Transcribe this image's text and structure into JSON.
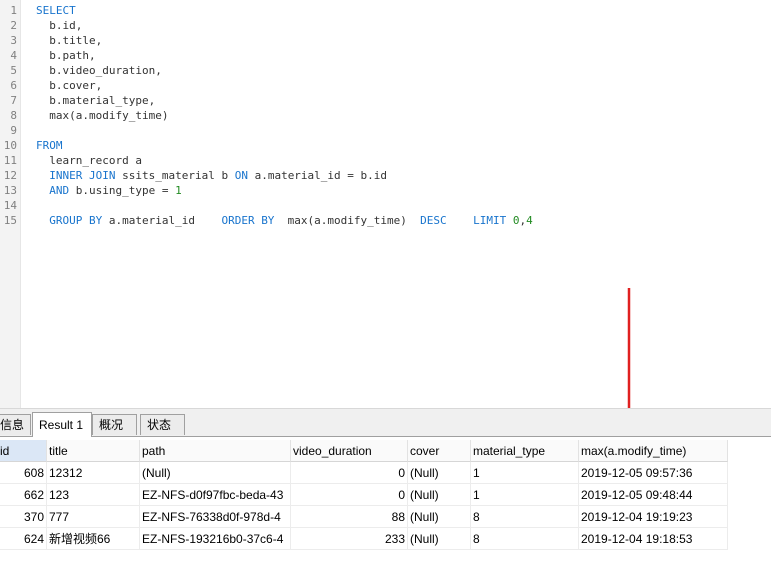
{
  "editor": {
    "lines": [
      {
        "num": "1",
        "parts": [
          {
            "t": "SELECT",
            "c": "kw"
          }
        ]
      },
      {
        "num": "2",
        "parts": [
          {
            "t": "  b.id,",
            "c": ""
          }
        ]
      },
      {
        "num": "3",
        "parts": [
          {
            "t": "  b.title,",
            "c": ""
          }
        ]
      },
      {
        "num": "4",
        "parts": [
          {
            "t": "  b.path,",
            "c": ""
          }
        ]
      },
      {
        "num": "5",
        "parts": [
          {
            "t": "  b.video_duration,",
            "c": ""
          }
        ]
      },
      {
        "num": "6",
        "parts": [
          {
            "t": "  b.cover,",
            "c": ""
          }
        ]
      },
      {
        "num": "7",
        "parts": [
          {
            "t": "  b.material_type,",
            "c": ""
          }
        ]
      },
      {
        "num": "8",
        "parts": [
          {
            "t": "  max(a.modify_time)",
            "c": ""
          }
        ]
      },
      {
        "num": "9",
        "parts": []
      },
      {
        "num": "10",
        "parts": [
          {
            "t": "FROM",
            "c": "kw"
          }
        ]
      },
      {
        "num": "11",
        "parts": [
          {
            "t": "  learn_record a",
            "c": ""
          }
        ]
      },
      {
        "num": "12",
        "parts": [
          {
            "t": "  INNER JOIN",
            "c": "kw"
          },
          {
            "t": " ssits_material b ",
            "c": ""
          },
          {
            "t": "ON",
            "c": "kw"
          },
          {
            "t": " a.material_id = b.id",
            "c": ""
          }
        ]
      },
      {
        "num": "13",
        "parts": [
          {
            "t": "  AND",
            "c": "kw"
          },
          {
            "t": " b.using_type = ",
            "c": ""
          },
          {
            "t": "1",
            "c": "num"
          }
        ]
      },
      {
        "num": "14",
        "parts": []
      },
      {
        "num": "15",
        "parts": [
          {
            "t": "  GROUP BY",
            "c": "kw"
          },
          {
            "t": " a.material_id    ",
            "c": ""
          },
          {
            "t": "ORDER BY",
            "c": "kw"
          },
          {
            "t": "  max(a.modify_time)  ",
            "c": ""
          },
          {
            "t": "DESC",
            "c": "kw"
          },
          {
            "t": "    ",
            "c": ""
          },
          {
            "t": "LIMIT",
            "c": "kw"
          },
          {
            "t": " ",
            "c": ""
          },
          {
            "t": "0",
            "c": "num"
          },
          {
            "t": ",",
            "c": ""
          },
          {
            "t": "4",
            "c": "num"
          }
        ]
      }
    ]
  },
  "tabs": [
    {
      "label": "信息",
      "active": false
    },
    {
      "label": "Result 1",
      "active": true
    },
    {
      "label": "概况",
      "active": false
    },
    {
      "label": "状态",
      "active": false
    }
  ],
  "grid": {
    "columns": [
      "id",
      "title",
      "path",
      "video_duration",
      "cover",
      "material_type",
      "max(a.modify_time)"
    ],
    "rows": [
      [
        "608",
        "12312",
        "(Null)",
        "0",
        "(Null)",
        "1",
        "2019-12-05 09:57:36"
      ],
      [
        "662",
        "123",
        "EZ-NFS-d0f97fbc-beda-43",
        "0",
        "(Null)",
        "1",
        "2019-12-05 09:48:44"
      ],
      [
        "370",
        "777",
        "EZ-NFS-76338d0f-978d-4",
        "88",
        "(Null)",
        "8",
        "2019-12-04 19:19:23"
      ],
      [
        "624",
        "新增视频66",
        "EZ-NFS-193216b0-37c6-4",
        "233",
        "(Null)",
        "8",
        "2019-12-04 19:18:53"
      ]
    ],
    "null_color": "#b4b4b4"
  },
  "annotation": {
    "arrow_color": "#e02020"
  }
}
